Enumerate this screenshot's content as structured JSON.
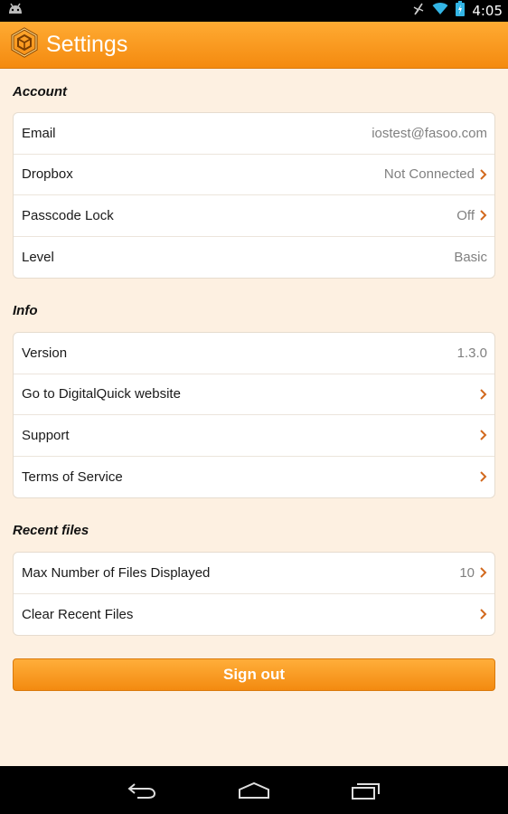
{
  "status_bar": {
    "time": "4:05",
    "icons": [
      "android-debug-icon",
      "signal-muted-icon",
      "wifi-icon",
      "battery-charging-icon"
    ]
  },
  "app_bar": {
    "title": "Settings",
    "logo_icon": "hexagon-cube-logo-icon",
    "accent_color": "#f7941d"
  },
  "sections": {
    "account": {
      "header": "Account",
      "rows": [
        {
          "label": "Email",
          "value": "iostest@fasoo.com"
        },
        {
          "label": "Dropbox",
          "value": "Not Connected"
        },
        {
          "label": "Passcode Lock",
          "value": "Off"
        },
        {
          "label": "Level",
          "value": "Basic"
        }
      ]
    },
    "info": {
      "header": "Info",
      "rows": [
        {
          "label": "Version",
          "value": "1.3.0"
        },
        {
          "label": "Go to DigitalQuick website",
          "value": ""
        },
        {
          "label": "Support",
          "value": ""
        },
        {
          "label": "Terms of Service",
          "value": ""
        }
      ]
    },
    "recent": {
      "header": "Recent files",
      "rows": [
        {
          "label": "Max Number of Files Displayed",
          "value": "10"
        },
        {
          "label": "Clear Recent Files",
          "value": ""
        }
      ]
    }
  },
  "signout_label": "Sign out",
  "nav_bar": {
    "icons": [
      "back-icon",
      "home-icon",
      "recent-apps-icon"
    ]
  }
}
